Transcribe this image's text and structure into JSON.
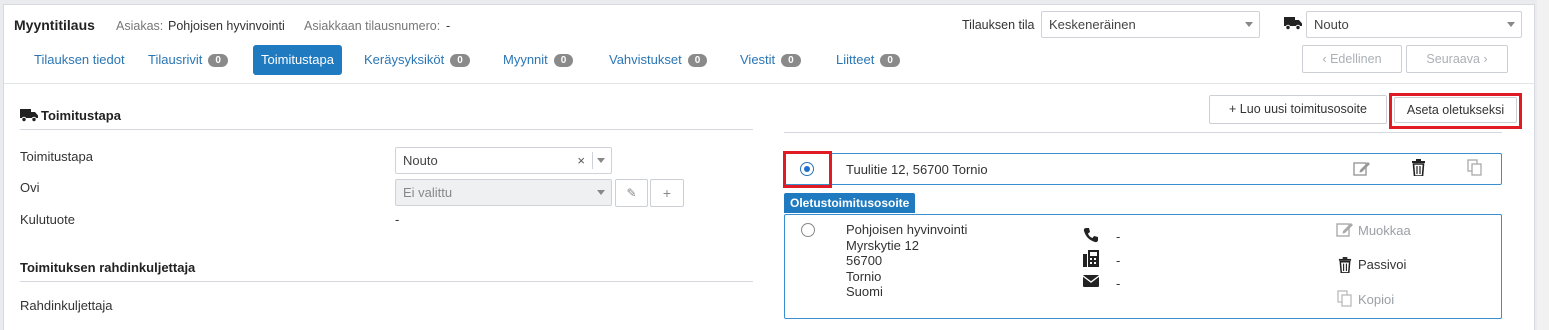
{
  "header": {
    "title": "Myyntitilaus",
    "customer_label": "Asiakas:",
    "customer_value": "Pohjoisen hyvinvointi",
    "order_number_label": "Asiakkaan tilausnumero:",
    "order_number_value": "-",
    "status_label": "Tilauksen tila",
    "status_value": "Keskeneräinen",
    "delivery_value": "Nouto"
  },
  "tabs": [
    {
      "label": "Tilauksen tiedot"
    },
    {
      "label": "Tilausrivit",
      "badge": "0"
    },
    {
      "label": "Toimitustapa"
    },
    {
      "label": "Keräysyksiköt",
      "badge": "0"
    },
    {
      "label": "Myynnit",
      "badge": "0"
    },
    {
      "label": "Vahvistukset",
      "badge": "0"
    },
    {
      "label": "Viestit",
      "badge": "0"
    },
    {
      "label": "Liitteet",
      "badge": "0"
    }
  ],
  "nav": {
    "prev": "‹ Edellinen",
    "next": "Seuraava ›"
  },
  "left": {
    "section_title": "Toimitustapa",
    "fields": {
      "method_label": "Toimitustapa",
      "method_value": "Nouto",
      "door_label": "Ovi",
      "door_placeholder": "Ei valittu",
      "consumable_label": "Kulutuote",
      "consumable_value": "-"
    },
    "carrier_title": "Toimituksen rahdinkuljettaja",
    "carrier_label": "Rahdinkuljettaja"
  },
  "right": {
    "new_address_button": "+ Luo uusi toimitusosoite",
    "set_default_button": "Aseta oletukseksi",
    "address1": "Tuulitie 12, 56700 Tornio",
    "default_tag": "Oletustoimitusosoite",
    "default_address": {
      "name": "Pohjoisen hyvinvointi",
      "street": "Myrskytie 12",
      "zip": "56700",
      "city": "Tornio",
      "country": "Suomi",
      "phone": "-",
      "fax": "-",
      "email": "-"
    },
    "actions": {
      "edit": "Muokkaa",
      "passivate": "Passivoi",
      "copy": "Kopioi"
    }
  }
}
